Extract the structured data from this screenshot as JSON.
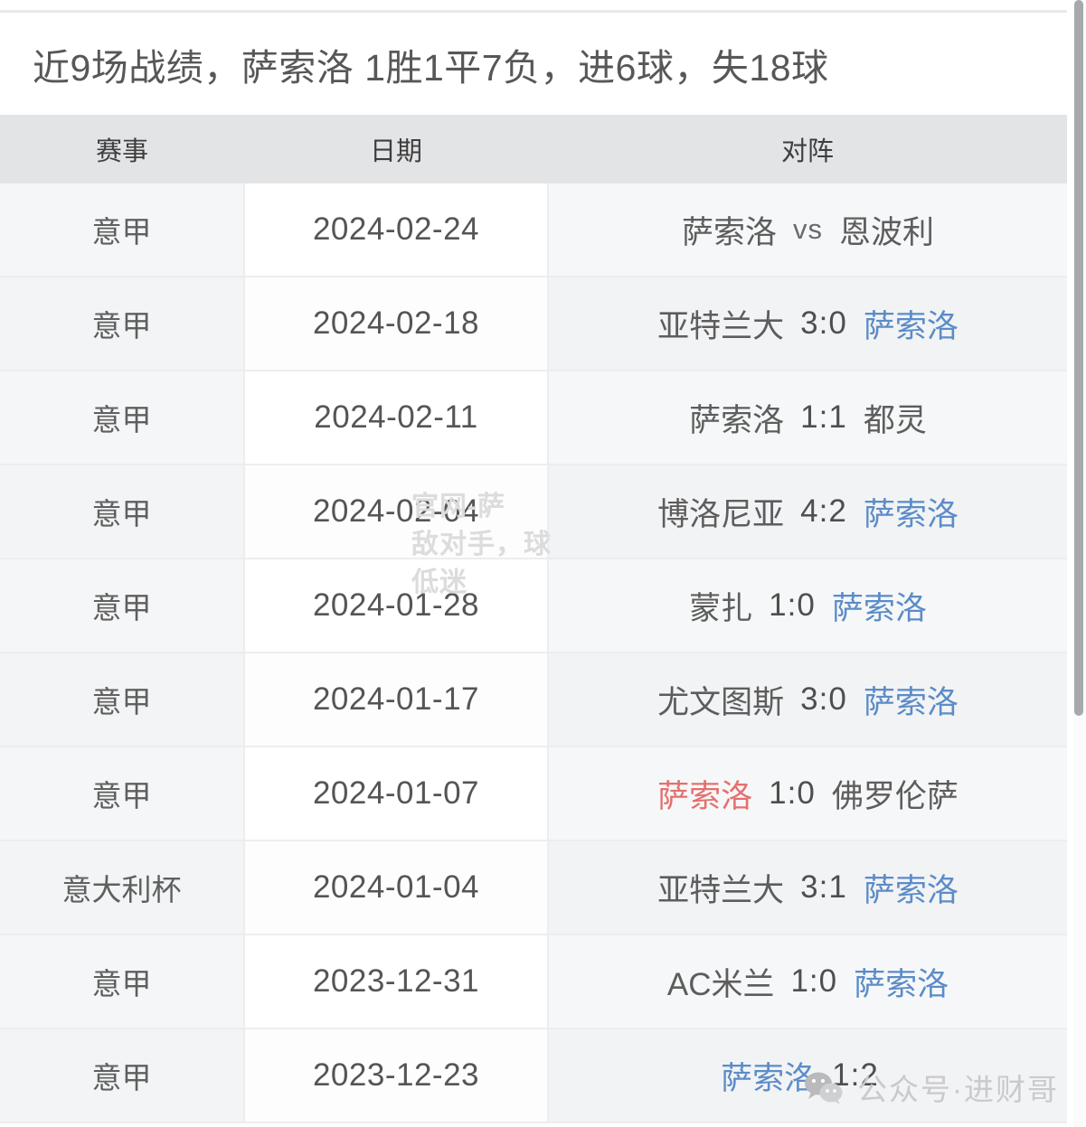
{
  "header": {
    "title": "近9场战绩，萨索洛 1胜1平7负，进6球，失18球"
  },
  "table": {
    "columns": [
      {
        "key": "competition",
        "label": "赛事"
      },
      {
        "key": "date",
        "label": "日期"
      },
      {
        "key": "match",
        "label": "对阵"
      }
    ],
    "rows": [
      {
        "competition": "意甲",
        "date": "2024-02-24",
        "home": "萨索洛",
        "score": "vs",
        "away": "恩波利",
        "home_result": "none",
        "away_result": "none"
      },
      {
        "competition": "意甲",
        "date": "2024-02-18",
        "home": "亚特兰大",
        "score": "3:0",
        "away": "萨索洛",
        "home_result": "none",
        "away_result": "loss"
      },
      {
        "competition": "意甲",
        "date": "2024-02-11",
        "home": "萨索洛",
        "score": "1:1",
        "away": "都灵",
        "home_result": "none",
        "away_result": "none"
      },
      {
        "competition": "意甲",
        "date": "2024-02-04",
        "home": "博洛尼亚",
        "score": "4:2",
        "away": "萨索洛",
        "home_result": "none",
        "away_result": "loss"
      },
      {
        "competition": "意甲",
        "date": "2024-01-28",
        "home": "蒙扎",
        "score": "1:0",
        "away": "萨索洛",
        "home_result": "none",
        "away_result": "loss"
      },
      {
        "competition": "意甲",
        "date": "2024-01-17",
        "home": "尤文图斯",
        "score": "3:0",
        "away": "萨索洛",
        "home_result": "none",
        "away_result": "loss"
      },
      {
        "competition": "意甲",
        "date": "2024-01-07",
        "home": "萨索洛",
        "score": "1:0",
        "away": "佛罗伦萨",
        "home_result": "win",
        "away_result": "none"
      },
      {
        "competition": "意大利杯",
        "date": "2024-01-04",
        "home": "亚特兰大",
        "score": "3:1",
        "away": "萨索洛",
        "home_result": "none",
        "away_result": "loss"
      },
      {
        "competition": "意甲",
        "date": "2023-12-31",
        "home": "AC米兰",
        "score": "1:0",
        "away": "萨索洛",
        "home_result": "none",
        "away_result": "loss"
      },
      {
        "competition": "意甲",
        "date": "2023-12-23",
        "home": "萨索洛",
        "score": "1:2",
        "away": "",
        "home_result": "loss",
        "away_result": "none"
      }
    ]
  },
  "watermarks": {
    "center_text": "官网-萨\n敌对手，球\n低迷",
    "brand_text": "公众号·进财哥"
  },
  "colors": {
    "loss": "#5b8cc8",
    "win": "#e4706e",
    "header_bg": "#e3e4e6",
    "text": "#5c5c5c"
  }
}
